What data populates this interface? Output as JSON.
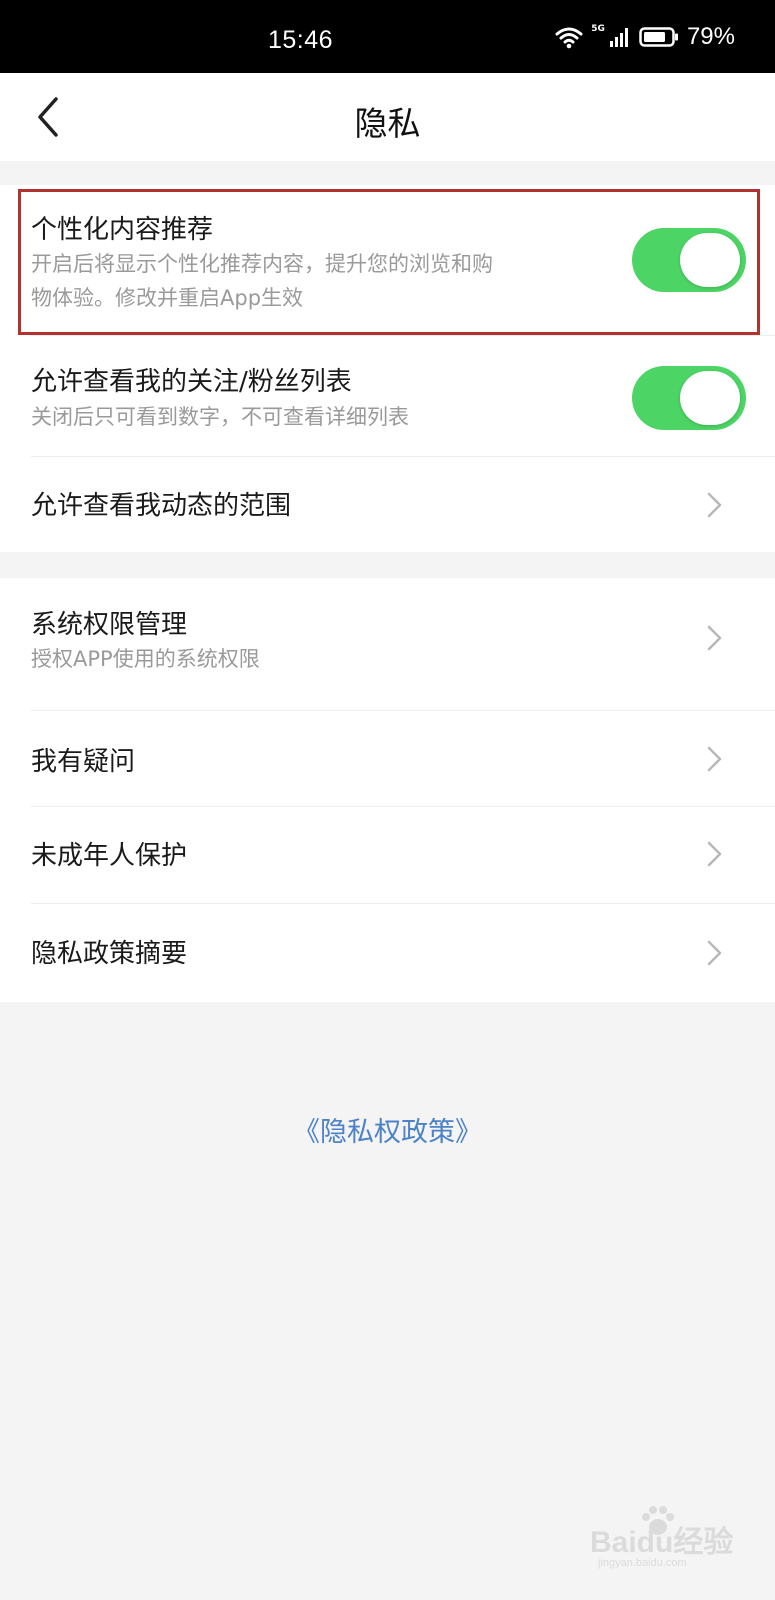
{
  "status_bar": {
    "time": "15:46",
    "network": "5G",
    "battery": "79%"
  },
  "header": {
    "title": "隐私"
  },
  "settings": {
    "personalized": {
      "title": "个性化内容推荐",
      "subtitle_line1": "开启后将显示个性化推荐内容，提升您的浏览和购",
      "subtitle_line2": "物体验。修改并重启App生效",
      "enabled": true
    },
    "follow_list": {
      "title": "允许查看我的关注/粉丝列表",
      "subtitle": "关闭后只可看到数字，不可查看详细列表",
      "enabled": true
    },
    "moments_scope": {
      "title": "允许查看我动态的范围"
    }
  },
  "more": {
    "permissions": {
      "title": "系统权限管理",
      "subtitle": "授权APP使用的系统权限"
    },
    "questions": {
      "title": "我有疑问"
    },
    "minor_protection": {
      "title": "未成年人保护"
    },
    "policy_summary": {
      "title": "隐私政策摘要"
    }
  },
  "footer": {
    "policy_link": "《隐私权政策》"
  },
  "watermark": {
    "text": "Baidu经验",
    "sub": "jingyan.baidu.com"
  },
  "colors": {
    "toggle_on": "#4cd465",
    "highlight": "#b3312e",
    "link": "#4d82c7"
  }
}
